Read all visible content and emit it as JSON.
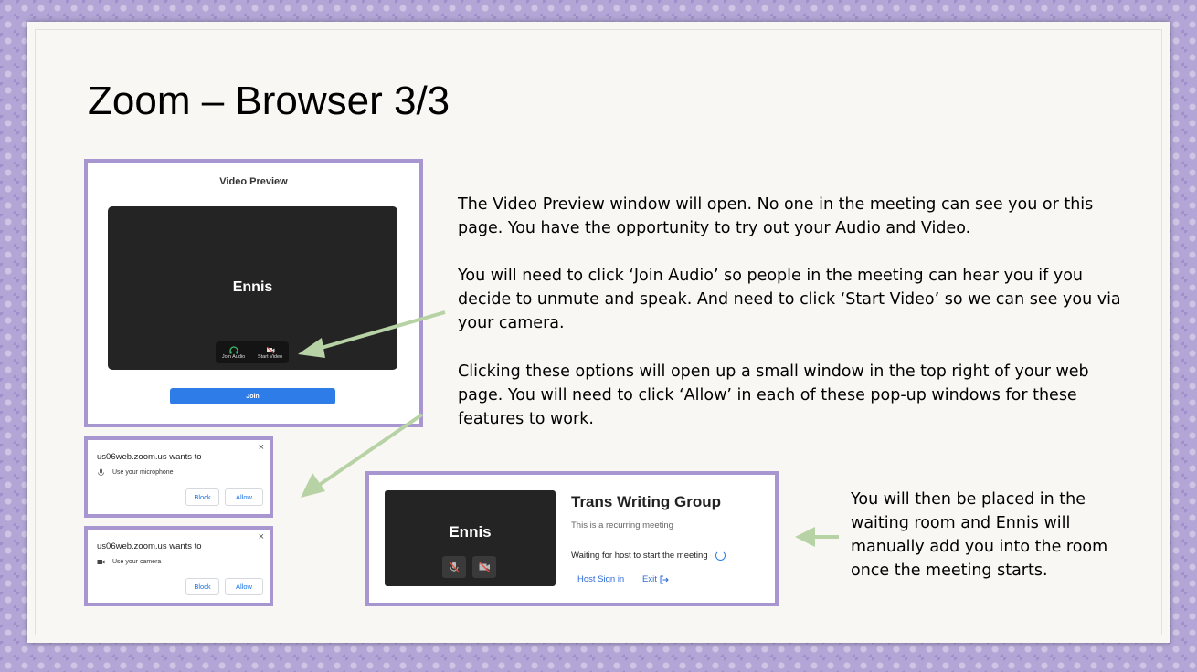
{
  "slide": {
    "title": "Zoom – Browser 3/3"
  },
  "video_preview": {
    "title": "Video Preview",
    "name": "Ennis",
    "join_audio_label": "Join Audio",
    "start_video_label": "Start Video",
    "join_button": "Join"
  },
  "popups": [
    {
      "site": "us06web.zoom.us wants to",
      "permission": "Use your microphone",
      "permission_icon": "microphone-icon",
      "block": "Block",
      "allow": "Allow",
      "close": "×"
    },
    {
      "site": "us06web.zoom.us wants to",
      "permission": "Use your camera",
      "permission_icon": "camera-icon",
      "block": "Block",
      "allow": "Allow",
      "close": "×"
    }
  ],
  "waiting_room": {
    "name": "Ennis",
    "title": "Trans Writing Group",
    "subtitle": "This is a recurring meeting",
    "status": "Waiting for host to start the meeting",
    "host_sign_in": "Host Sign in",
    "exit": "Exit"
  },
  "paragraphs": {
    "p1": "The Video Preview window will open. No one in the meeting can see you or this page. You have the opportunity to try out your Audio and Video.",
    "p2": "You will need to click ‘Join Audio’ so people in the meeting can hear you if you decide to unmute and speak. And need to click ‘Start Video’ so we can see you via your camera.",
    "p3": "Clicking these options will open up a small window in the top right of your web page. You will need to click ‘Allow’ in each of these pop-up windows for these features to work.",
    "p4": "You will then be placed in the waiting room and Ennis will manually add you into the room once the meeting starts."
  },
  "colors": {
    "frame": "#a796cf",
    "arrow": "#b7d3a6",
    "join_blue": "#2d7ce8",
    "background_purple": "#b3a6d6"
  }
}
